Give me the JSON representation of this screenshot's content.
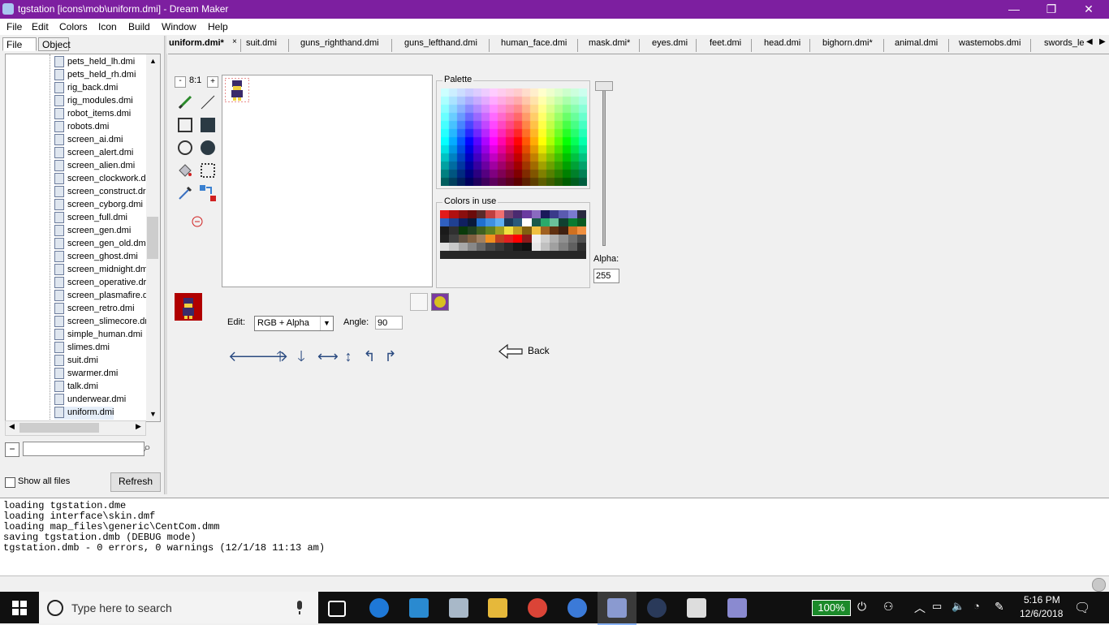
{
  "window": {
    "title": "tgstation [icons\\mob\\uniform.dmi] - Dream Maker",
    "minimize_glyph": "—",
    "restore_glyph": "❐",
    "close_glyph": "✕"
  },
  "menu": [
    "File",
    "Edit",
    "Colors",
    "Icon",
    "Build",
    "Window",
    "Help"
  ],
  "left_tabs": [
    "File",
    "Object"
  ],
  "tree_items": [
    "pets_held_lh.dmi",
    "pets_held_rh.dmi",
    "rig_back.dmi",
    "rig_modules.dmi",
    "robot_items.dmi",
    "robots.dmi",
    "screen_ai.dmi",
    "screen_alert.dmi",
    "screen_alien.dmi",
    "screen_clockwork.d",
    "screen_construct.dr",
    "screen_cyborg.dmi",
    "screen_full.dmi",
    "screen_gen.dmi",
    "screen_gen_old.dmi",
    "screen_ghost.dmi",
    "screen_midnight.dm",
    "screen_operative.dr",
    "screen_plasmafire.d",
    "screen_retro.dmi",
    "screen_slimecore.dr",
    "simple_human.dmi",
    "slimes.dmi",
    "suit.dmi",
    "swarmer.dmi",
    "talk.dmi",
    "underwear.dmi",
    "uniform.dmi"
  ],
  "search": {
    "value": ""
  },
  "show_all_files": {
    "label": "Show all files",
    "checked": false
  },
  "refresh_label": "Refresh",
  "file_tabs": [
    "uniform.dmi*",
    "suit.dmi",
    "guns_righthand.dmi",
    "guns_lefthand.dmi",
    "human_face.dmi",
    "mask.dmi*",
    "eyes.dmi",
    "feet.dmi",
    "head.dmi",
    "bighorn.dmi*",
    "animal.dmi",
    "wastemobs.dmi",
    "swords_le"
  ],
  "editor": {
    "zoom": "8:1",
    "zoom_minus": "-",
    "zoom_plus": "+",
    "palette_label": "Palette",
    "colors_in_use_label": "Colors in use",
    "alpha_label": "Alpha:",
    "alpha_value": "255",
    "edit_label": "Edit:",
    "edit_mode": "RGB + Alpha",
    "angle_label": "Angle:",
    "angle_value": "90",
    "back_label": "Back",
    "colors_in_use": [
      "#e31b1b",
      "#b01010",
      "#8a0f0f",
      "#6b0b0b",
      "#5a2a2a",
      "#c04040",
      "#f07070",
      "#704070",
      "#4a2a70",
      "#6a3aa0",
      "#8a6ac0",
      "#1a1a5a",
      "#3a3a8a",
      "#5a5ab0",
      "#7a7ad0",
      "#2a2a40",
      "#3060c0",
      "#204090",
      "#102060",
      "#0a1a3a",
      "#2070d0",
      "#4090e0",
      "#60b0f0",
      "#1a3a5a",
      "#2a5a7a",
      "#ffffff",
      "#1a5a4a",
      "#2aaa6a",
      "#6ac09a",
      "#104030",
      "#0a7a30",
      "#0a5a20",
      "#1a1a1a",
      "#303030",
      "#0a3a0a",
      "#204020",
      "#406020",
      "#608020",
      "#a0a020",
      "#f0e040",
      "#c0a020",
      "#806010",
      "#f0c040",
      "#a06020",
      "#603010",
      "#402010",
      "#d07020",
      "#f09040",
      "#202020",
      "#404040",
      "#605040",
      "#806040",
      "#a08060",
      "#f09020",
      "#c04020",
      "#e02020",
      "#ff0000",
      "#8a1a1a",
      "#f0f0f0",
      "#d0d0d0",
      "#b0b0b0",
      "#909090",
      "#707070",
      "#505050",
      "#e0e0e0",
      "#c8c8c8",
      "#a8a8a8",
      "#888888",
      "#686868",
      "#484848",
      "#383838",
      "#282828",
      "#181818",
      "#101010",
      "#e8e8e8",
      "#c0c0c0",
      "#a0a0a0",
      "#808080",
      "#606060",
      "#303030",
      "#262626",
      "#262626",
      "#262626",
      "#262626",
      "#262626",
      "#262626",
      "#262626",
      "#262626",
      "#262626",
      "#262626",
      "#262626",
      "#262626",
      "#262626",
      "#262626",
      "#262626",
      "#262626"
    ]
  },
  "output_lines": [
    "loading tgstation.dme",
    "loading interface\\skin.dmf",
    "loading map_files\\generic\\CentCom.dmm",
    "saving tgstation.dmb (DEBUG mode)",
    "tgstation.dmb - 0 errors, 0 warnings (12/1/18 11:13 am)"
  ],
  "taskbar": {
    "search_placeholder": "Type here to search",
    "battery": "100%",
    "time": "5:16 PM",
    "date": "12/6/2018"
  }
}
